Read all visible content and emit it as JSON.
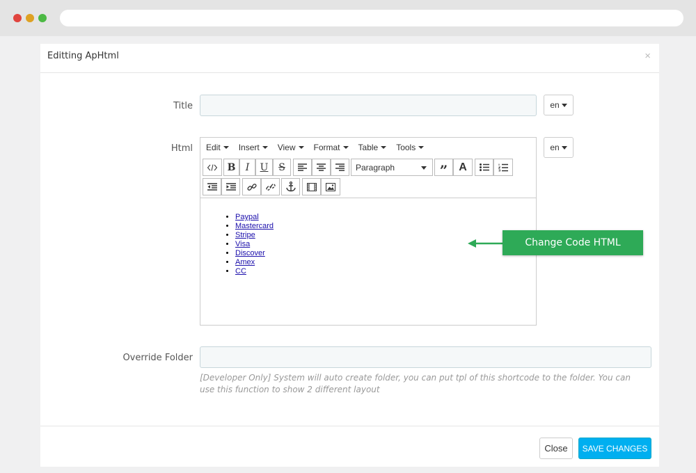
{
  "modal": {
    "title": "Editting ApHtml",
    "close_symbol": "×"
  },
  "form": {
    "title_label": "Title",
    "title_value": "",
    "html_label": "Html",
    "override_label": "Override Folder",
    "override_value": "",
    "lang_title": "en",
    "lang_html": "en",
    "help_text": "[Developer Only] System will auto create folder, you can put tpl of this shortcode to the folder. You can use this function to show 2 different layout"
  },
  "editor": {
    "menus": [
      "Edit",
      "Insert",
      "View",
      "Format",
      "Table",
      "Tools"
    ],
    "format_select": "Paragraph",
    "toolbar_icons": [
      "code-icon",
      "bold-icon",
      "italic-icon",
      "underline-icon",
      "strikethrough-icon",
      "align-left-icon",
      "align-center-icon",
      "align-right-icon",
      "blockquote-icon",
      "text-color-icon",
      "bullet-list-icon",
      "numbered-list-icon",
      "outdent-icon",
      "indent-icon",
      "link-icon",
      "unlink-icon",
      "anchor-icon",
      "media-icon",
      "image-icon"
    ],
    "content_links": [
      "Paypal",
      "Mastercard",
      "Stripe",
      "Visa",
      "Discover",
      "Amex",
      "CC"
    ]
  },
  "annotation": {
    "text": "Change Code HTML",
    "color": "#2eaa57"
  },
  "footer": {
    "close_label": "Close",
    "save_label": "SAVE CHANGES",
    "save_color": "#00aff0"
  }
}
